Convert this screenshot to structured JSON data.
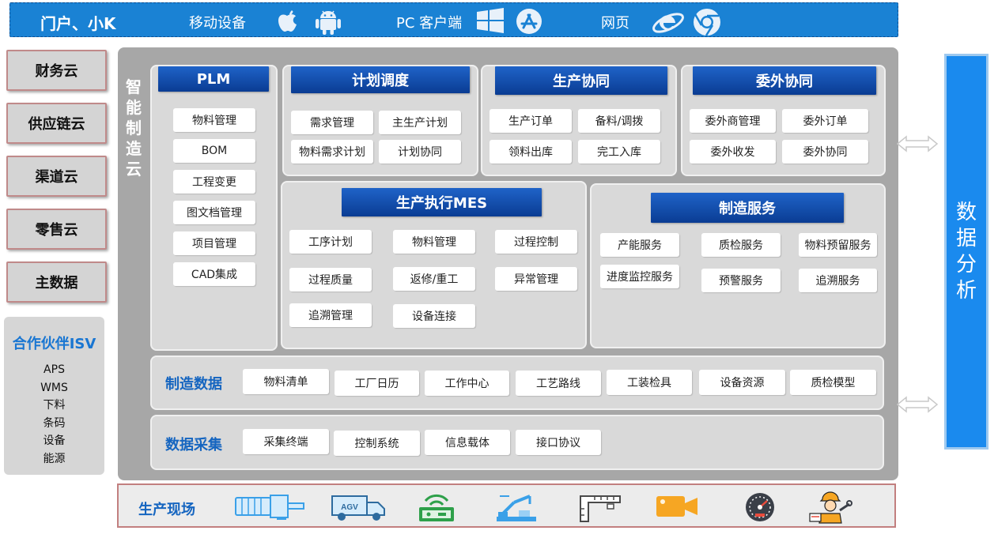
{
  "top_bar": {
    "title": "门户、小K",
    "mobile_label": "移动设备",
    "pc_label": "PC 客户端",
    "web_label": "网页"
  },
  "left_nav": {
    "items": [
      "财务云",
      "供应链云",
      "渠道云",
      "零售云",
      "主数据"
    ],
    "partner": {
      "title": "合作伙伴ISV",
      "items": [
        "APS",
        "WMS",
        "下料",
        "条码",
        "设备",
        "能源"
      ]
    }
  },
  "main": {
    "vertical_title": [
      "智",
      "能",
      "制",
      "造",
      "云"
    ],
    "plm": {
      "title": "PLM",
      "items": [
        "物料管理",
        "BOM",
        "工程变更",
        "图文档管理",
        "项目管理",
        "CAD集成"
      ]
    },
    "planning": {
      "title": "计划调度",
      "items": [
        "需求管理",
        "主生产计划",
        "物料需求计划",
        "计划协同"
      ]
    },
    "production_collab": {
      "title": "生产协同",
      "items": [
        "生产订单",
        "备料/调拨",
        "领料出库",
        "完工入库"
      ]
    },
    "outsourcing": {
      "title": "委外协同",
      "items": [
        "委外商管理",
        "委外订单",
        "委外收发",
        "委外协同"
      ]
    },
    "mes": {
      "title": "生产执行MES",
      "items": [
        "工序计划",
        "物料管理",
        "过程控制",
        "过程质量",
        "返修/重工",
        "异常管理",
        "追溯管理",
        "设备连接"
      ]
    },
    "mfg_service": {
      "title": "制造服务",
      "items": [
        "产能服务",
        "质检服务",
        "物料预留服务",
        "进度监控服务",
        "预警服务",
        "追溯服务"
      ]
    },
    "mfg_data": {
      "label": "制造数据",
      "items": [
        "物料清单",
        "工厂日历",
        "工作中心",
        "工艺路线",
        "工装检具",
        "设备资源",
        "质检模型"
      ]
    },
    "data_collection": {
      "label": "数据采集",
      "items": [
        "采集终端",
        "控制系统",
        "信息载体",
        "接口协议"
      ]
    }
  },
  "analytics": {
    "chars": [
      "数",
      "据",
      "分",
      "析"
    ]
  },
  "field": {
    "label": "生产现场",
    "agv_text": "AGV",
    "icons": [
      "motor-icon",
      "agv-truck-icon",
      "wireless-device-icon",
      "robot-arm-icon",
      "ruler-gauge-icon",
      "camera-icon",
      "speedometer-icon",
      "worker-icon"
    ]
  },
  "colors": {
    "top_bar": "#1a82d4",
    "header_blue": "#0a3c93",
    "label_blue": "#1565c0",
    "analytics": "#1a8aee",
    "panel_gray": "#a7a7a7",
    "sub_gray": "#d9d9d9"
  }
}
